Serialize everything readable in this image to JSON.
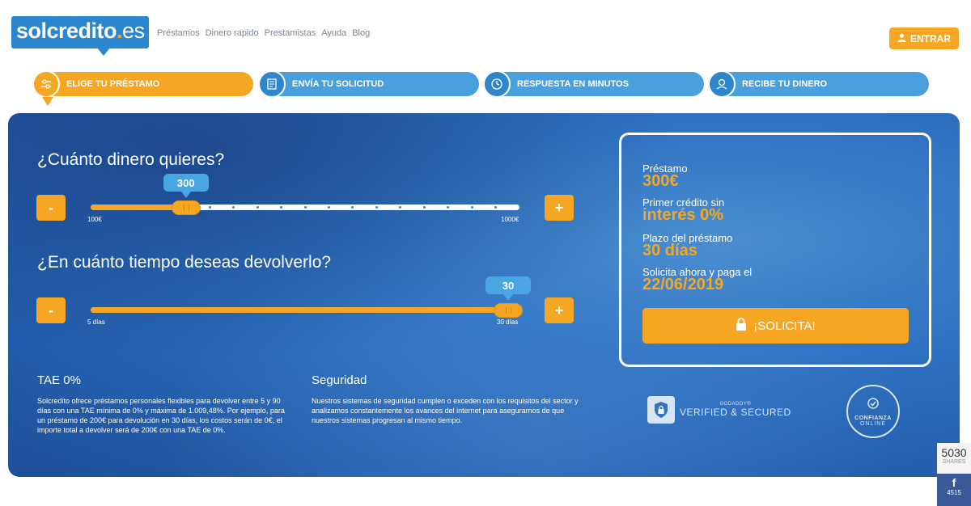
{
  "header": {
    "logo_main": "solcredito",
    "logo_dot": ".",
    "logo_suffix": "es",
    "nav": [
      "Préstamos",
      "Dinero rapido",
      "Prestamistas",
      "Ayuda",
      "Blog"
    ],
    "login_label": "ENTRAR",
    "login_icon": "user-icon"
  },
  "steps": [
    {
      "label": "ELIGE TU PRÉSTAMO",
      "icon": "sliders-icon",
      "active": true
    },
    {
      "label": "ENVÍA TU SOLICITUD",
      "icon": "document-icon",
      "active": false
    },
    {
      "label": "RESPUESTA EN MINUTOS",
      "icon": "clock-icon",
      "active": false
    },
    {
      "label": "RECIBE TU DINERO",
      "icon": "money-icon",
      "active": false
    }
  ],
  "amount": {
    "question": "¿Cuánto dinero quieres?",
    "value": "300",
    "value_num": 300,
    "min": 100,
    "max": 1000,
    "min_label": "100€",
    "max_label": "1000€",
    "minus": "-",
    "plus": "+"
  },
  "term": {
    "question": "¿En cuánto tiempo deseas devolverlo?",
    "value": "30",
    "value_num": 30,
    "min": 5,
    "max": 30,
    "min_label": "5 días",
    "max_label": "30 días",
    "minus": "-",
    "plus": "+"
  },
  "info": {
    "tae_title": "TAE 0%",
    "tae_text": "Solcredito ofrece préstamos personales flexibles para devolver entre 5 y 90 días con una TAE mínima de 0% y máxima de 1.009,48%. Por ejemplo, para un préstamo de 200€ para devolución en 30 días, los costos serán de 0€, el importe total a devolver será de 200€ con una TAE de 0%.",
    "security_title": "Seguridad",
    "security_text": "Nuestros sistemas de seguridad cumplen o exceden con los requisitos del sector y analizamos constantemente los avances del internet para asegurarnos de que nuestros sistemas progresan al mismo tiempo."
  },
  "summary": {
    "loan_label": "Préstamo",
    "loan_value": "300€",
    "first_label": "Primer crédito sin",
    "first_value": "interés 0%",
    "term_label": "Plazo del préstamo",
    "term_value": "30 días",
    "pay_label": "Solicita ahora y paga el",
    "pay_value": "22/06/2019",
    "cta_label": "¡SOLICITA!",
    "cta_icon": "lock-icon"
  },
  "badges": {
    "godaddy_small": "GODADDY®",
    "godaddy_big": "VERIFIED & SECURED",
    "confianza_a": "CONFIANZA",
    "confianza_b": "ONLINE"
  },
  "share": {
    "count": "5030",
    "label": "SHARES",
    "fb_icon": "f",
    "fb_count": "4515"
  },
  "colors": {
    "accent": "#f5a623",
    "primary": "#2a86cf",
    "panel": "#2f73c2",
    "facebook": "#3b5998"
  }
}
